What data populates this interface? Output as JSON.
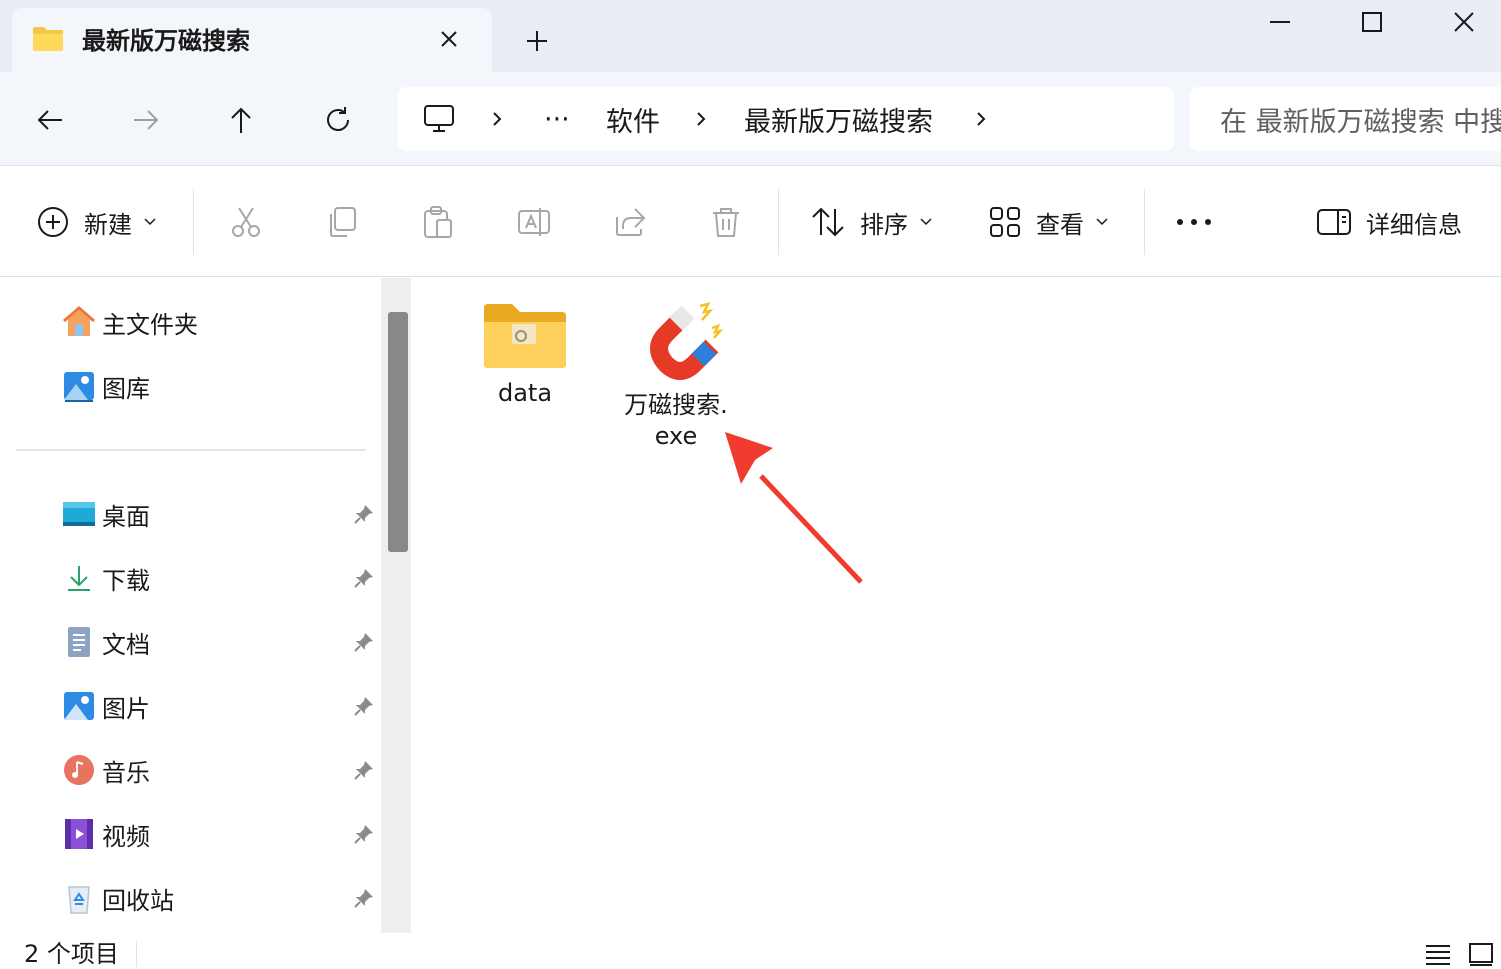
{
  "tab": {
    "title": "最新版万磁搜索"
  },
  "window": {
    "minimize": "minimize",
    "maximize": "maximize",
    "close": "close"
  },
  "address": {
    "segments": [
      "软件",
      "最新版万磁搜索"
    ],
    "overflow": "···",
    "search_placeholder": "在 最新版万磁搜索 中搜"
  },
  "toolbar": {
    "new_label": "新建",
    "sort_label": "排序",
    "view_label": "查看",
    "details_label": "详细信息"
  },
  "sidebar": {
    "top_items": [
      {
        "label": "主文件夹",
        "icon": "home-icon"
      },
      {
        "label": "图库",
        "icon": "gallery-icon"
      }
    ],
    "quick_access": [
      {
        "label": "桌面",
        "icon": "desktop-icon"
      },
      {
        "label": "下载",
        "icon": "download-icon"
      },
      {
        "label": "文档",
        "icon": "documents-icon"
      },
      {
        "label": "图片",
        "icon": "pictures-icon"
      },
      {
        "label": "音乐",
        "icon": "music-icon"
      },
      {
        "label": "视频",
        "icon": "videos-icon"
      },
      {
        "label": "回收站",
        "icon": "recycle-bin-icon"
      }
    ]
  },
  "files": [
    {
      "name_line1": "data",
      "name_line2": "",
      "type": "folder"
    },
    {
      "name_line1": "万磁搜索.",
      "name_line2": "exe",
      "type": "executable"
    }
  ],
  "status": {
    "item_count": "2 个项目"
  },
  "colors": {
    "accent_arrow": "#f03c2e",
    "folder": "#f6c744",
    "magnet_red": "#e53a26",
    "magnet_blue": "#2f7fd6"
  }
}
